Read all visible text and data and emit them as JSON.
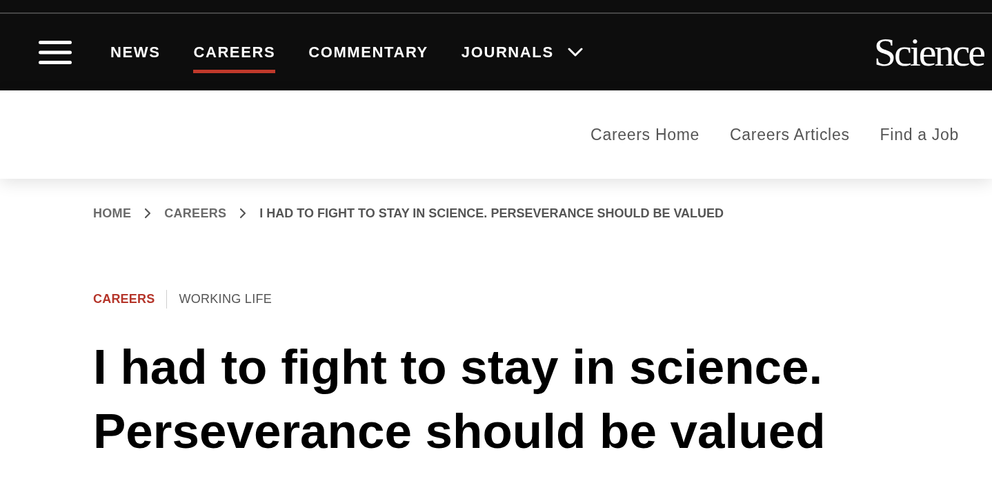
{
  "top_nav": {
    "items": [
      {
        "label": "NEWS",
        "kind": "link",
        "selected": false
      },
      {
        "label": "CAREERS",
        "kind": "link",
        "selected": true
      },
      {
        "label": "COMMENTARY",
        "kind": "link",
        "selected": false
      },
      {
        "label": "JOURNALS",
        "kind": "dropdown",
        "selected": false
      }
    ],
    "logo": "Science"
  },
  "sub_nav": {
    "items": [
      "Careers Home",
      "Careers Articles",
      "Find a Job"
    ]
  },
  "breadcrumb": {
    "items": [
      {
        "label": "HOME",
        "kind": "link"
      },
      {
        "label": "CAREERS",
        "kind": "link"
      },
      {
        "label": "I HAD TO FIGHT TO STAY IN SCIENCE. PERSEVERANCE SHOULD BE VALUED",
        "kind": "current"
      }
    ]
  },
  "article": {
    "section": "CAREERS",
    "category": "WORKING LIFE",
    "title": "I had to fight to stay in science. Perseverance should be valued"
  }
}
